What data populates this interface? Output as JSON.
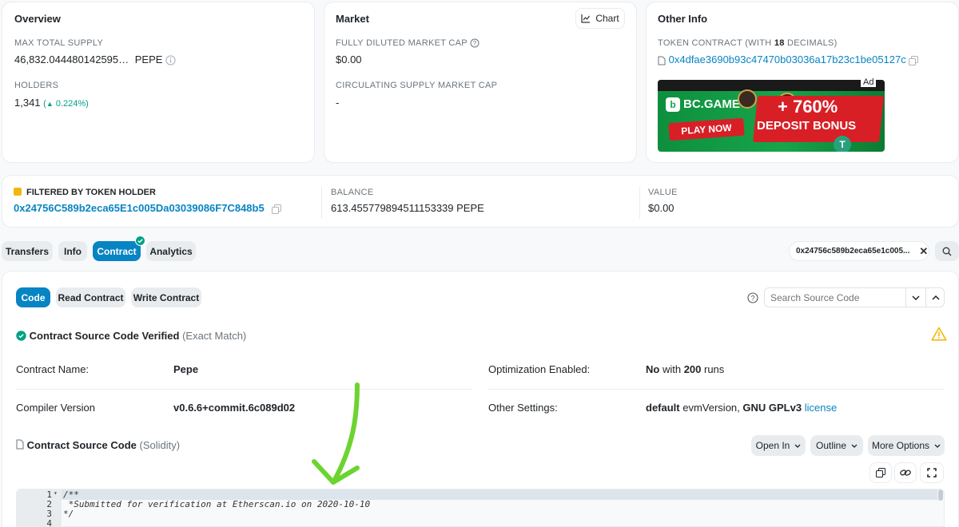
{
  "overview": {
    "title": "Overview",
    "max_supply_label": "MAX TOTAL SUPPLY",
    "max_supply_value": "46,832.044480142595…",
    "max_supply_unit": "PEPE",
    "holders_label": "HOLDERS",
    "holders_value": "1,341",
    "holders_change": "0.224%"
  },
  "market": {
    "title": "Market",
    "chart_button": "Chart",
    "fdmc_label": "FULLY DILUTED MARKET CAP",
    "fdmc_value": "$0.00",
    "csmc_label": "CIRCULATING SUPPLY MARKET CAP",
    "csmc_value": "-"
  },
  "other_info": {
    "title": "Other Info",
    "contract_label_prefix": "TOKEN CONTRACT (WITH ",
    "contract_label_decimals": "18",
    "contract_label_suffix": " DECIMALS)",
    "contract_address": "0x4dfae3690b93c47470b03036a17b23c1be05127c",
    "ad_badge": "Ad",
    "ad": {
      "brand": "BC.GAME",
      "play_now": "PLAY NOW",
      "bonus_pct": "+ 760%",
      "bonus_text": "DEPOSIT BONUS"
    }
  },
  "filter": {
    "label": "FILTERED BY TOKEN HOLDER",
    "address": "0x24756C589b2eca65E1c005Da03039086F7C848b5",
    "balance_label": "BALANCE",
    "balance_value": "613.455779894511153339 PEPE",
    "value_label": "VALUE",
    "value_value": "$0.00"
  },
  "tabs": {
    "transfers": "Transfers",
    "info": "Info",
    "contract": "Contract",
    "analytics": "Analytics",
    "address_chip": "0x24756c589b2eca65e1c005..."
  },
  "contract_panel": {
    "code_btn": "Code",
    "read_btn": "Read Contract",
    "write_btn": "Write Contract",
    "search_placeholder": "Search Source Code",
    "verified_title": "Contract Source Code Verified",
    "verified_note": "(Exact Match)",
    "name_label": "Contract Name:",
    "name_value": "Pepe",
    "compiler_label": "Compiler Version",
    "compiler_value": "v0.6.6+commit.6c089d02",
    "opt_label": "Optimization Enabled:",
    "opt_value_a": "No",
    "opt_value_b": " with ",
    "opt_value_c": "200",
    "opt_value_d": " runs",
    "other_label": "Other Settings:",
    "other_a": "default",
    "other_b": " evmVersion, ",
    "other_c": "GNU GPLv3",
    "other_d": "license",
    "source_title": "Contract Source Code",
    "source_lang": "(Solidity)",
    "open_in": "Open In",
    "outline": "Outline",
    "more_options": "More Options"
  },
  "code": {
    "lines": [
      "1",
      "2",
      "3",
      "4"
    ],
    "text": [
      "/**",
      " *Submitted for verification at Etherscan.io on 2020-10-10",
      "*/",
      ""
    ]
  },
  "colors": {
    "accent": "#0784c3",
    "green": "#00a186",
    "arrow": "#6cd431"
  }
}
